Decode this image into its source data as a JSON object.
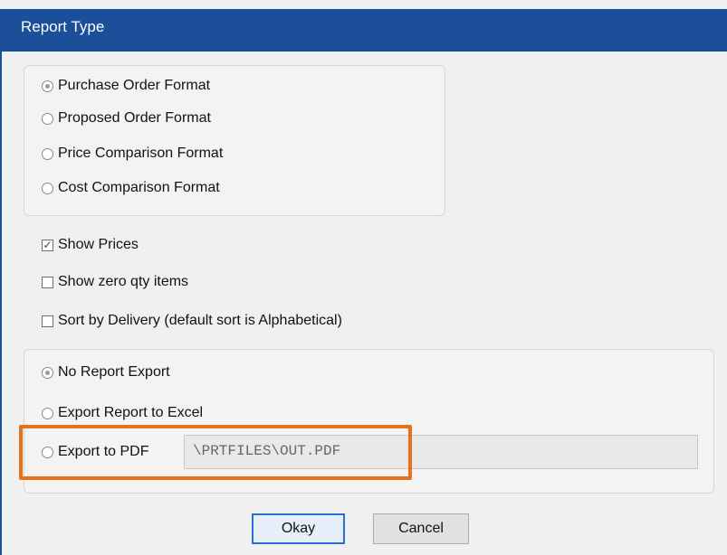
{
  "window": {
    "title": "Report Type"
  },
  "format": {
    "options": [
      {
        "label": "Purchase Order Format",
        "checked": true
      },
      {
        "label": "Proposed Order Format",
        "checked": false
      },
      {
        "label": "Price Comparison Format",
        "checked": false
      },
      {
        "label": "Cost Comparison Format",
        "checked": false
      }
    ]
  },
  "checks": [
    {
      "label": "Show Prices",
      "checked": true
    },
    {
      "label": "Show zero qty items",
      "checked": false
    },
    {
      "label": "Sort by Delivery (default sort is Alphabetical)",
      "checked": false
    }
  ],
  "export": {
    "options": [
      {
        "label": "No Report Export",
        "checked": true
      },
      {
        "label": "Export Report to Excel",
        "checked": false
      },
      {
        "label": "Export to PDF",
        "checked": false
      }
    ],
    "pdf_path": "\\PRTFILES\\OUT.PDF"
  },
  "buttons": {
    "okay": "Okay",
    "cancel": "Cancel"
  },
  "colors": {
    "titlebar": "#1c4f9a",
    "highlight": "#e6731a",
    "default_button_border": "#2a6fd1"
  }
}
